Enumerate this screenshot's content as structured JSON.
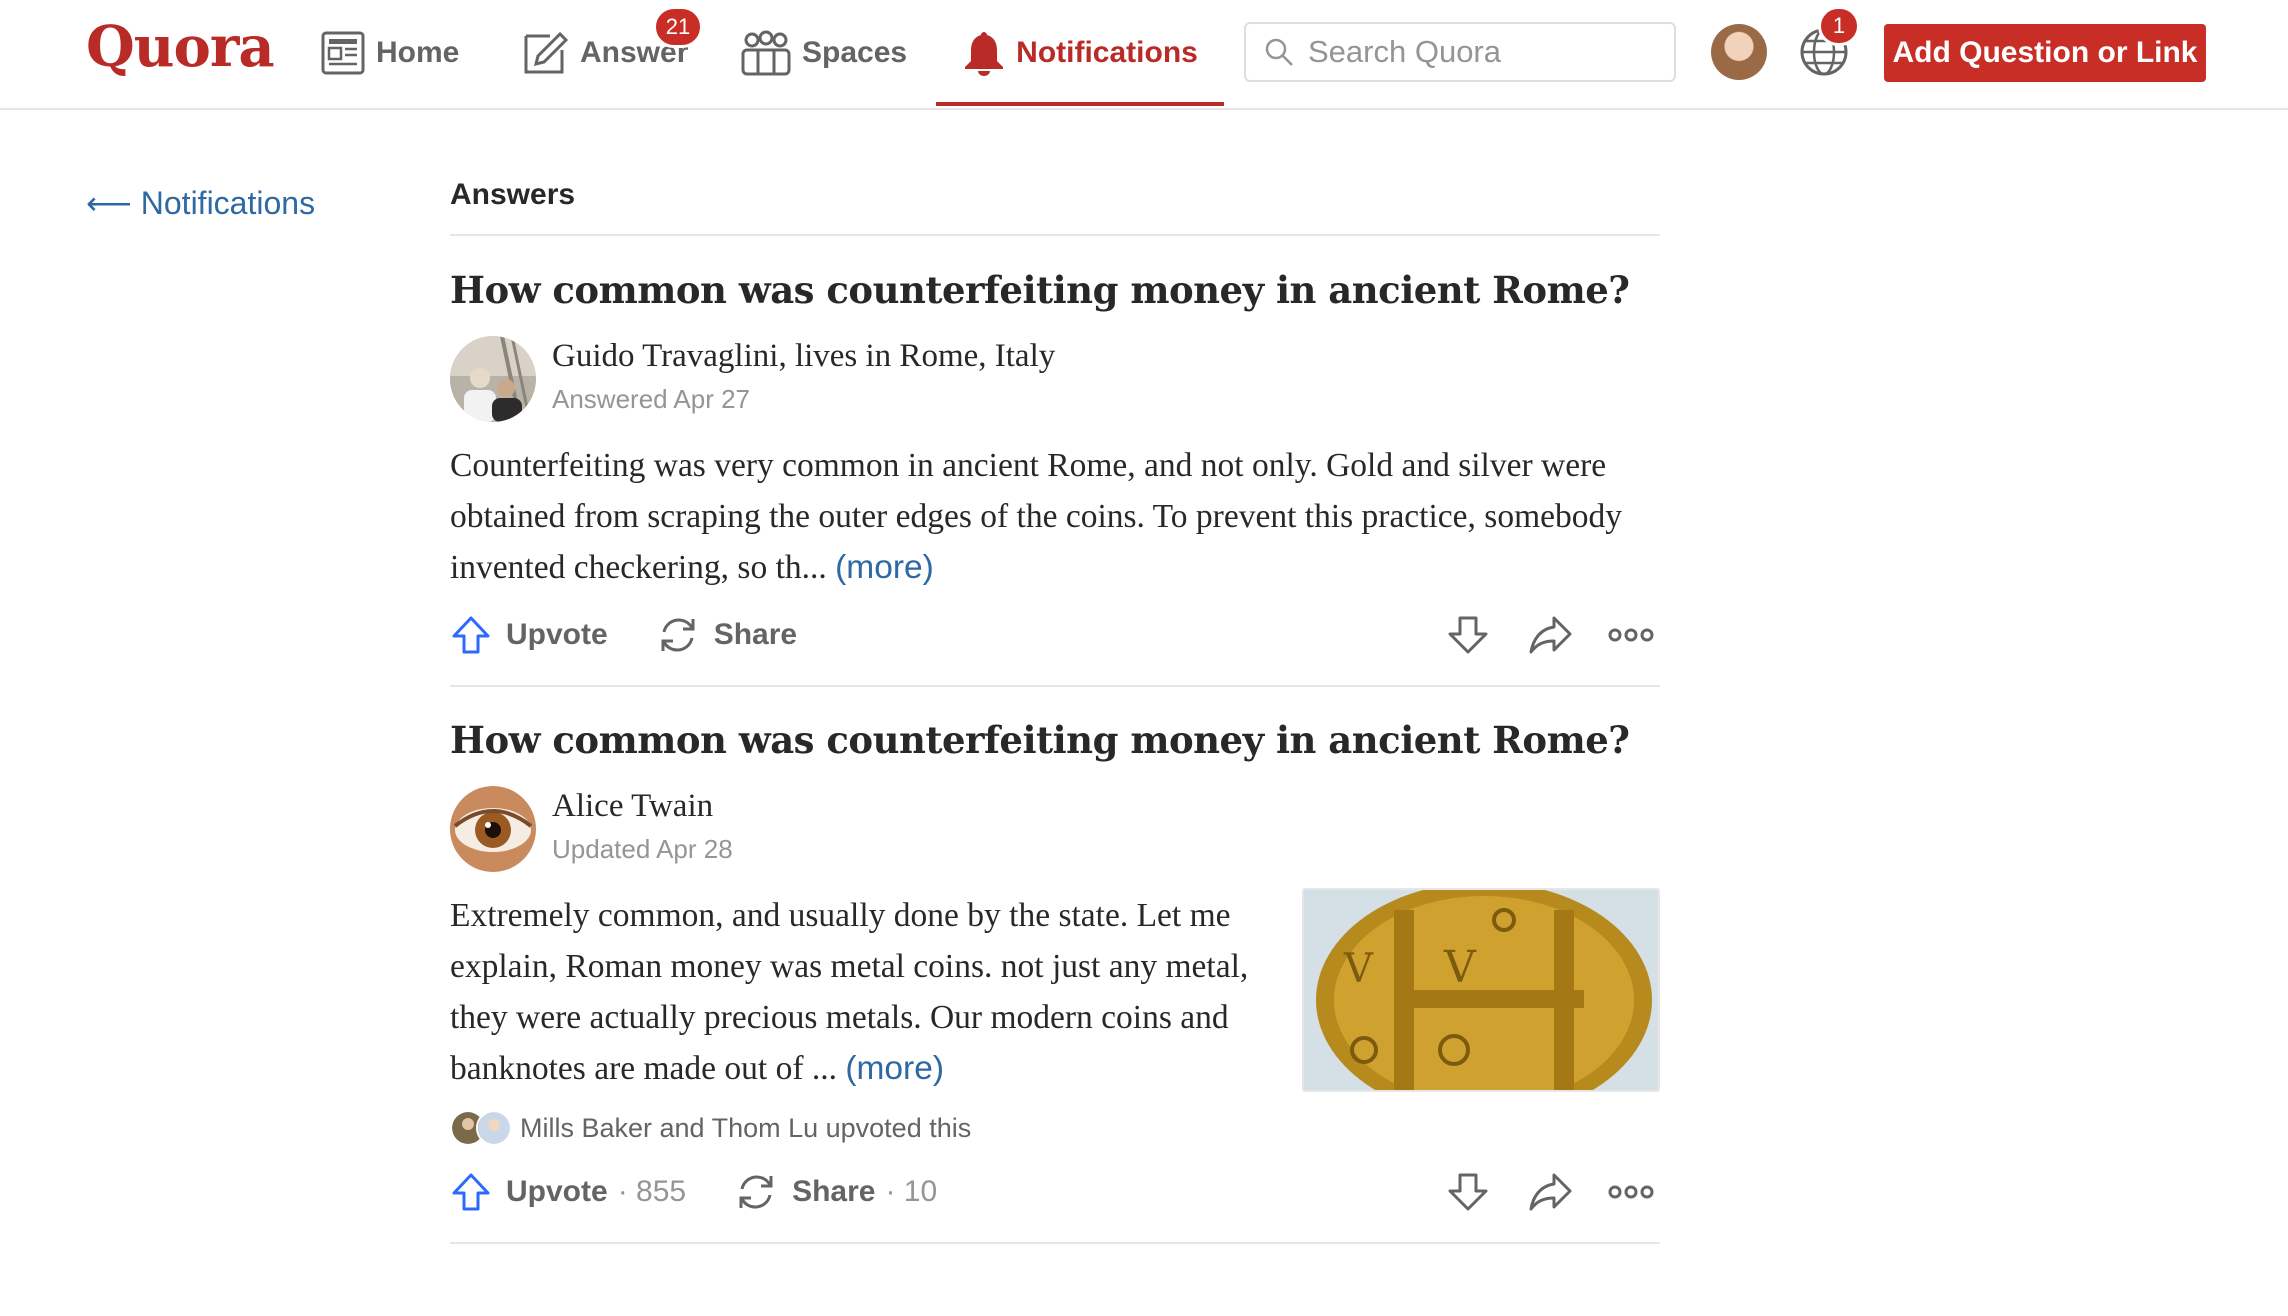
{
  "header": {
    "logo": "Quora",
    "nav": {
      "home": "Home",
      "answer": "Answer",
      "answer_badge": "21",
      "spaces": "Spaces",
      "notifications": "Notifications"
    },
    "search_placeholder": "Search Quora",
    "globe_badge": "1",
    "add_button": "Add Question or Link"
  },
  "sidebar": {
    "back_link": "⟵ Notifications"
  },
  "feed": {
    "section_title": "Answers",
    "answers": [
      {
        "question": "How common was counterfeiting money in ancient Rome?",
        "author": "Guido Travaglini, lives in Rome, Italy",
        "meta": "Answered Apr 27",
        "text": "Counterfeiting was very common in ancient Rome, and not only. Gold and silver were obtained from scraping the outer edges of the coins. To prevent this practice, somebody invented checkering, so th...",
        "more": "(more)",
        "upvote_label": "Upvote",
        "share_label": "Share"
      },
      {
        "question": "How common was counterfeiting money in ancient Rome?",
        "author": "Alice Twain",
        "meta": "Updated Apr 28",
        "text": "Extremely common, and usually done by the state. Let me explain, Roman money was metal coins. not just any metal, they were actually precious metals. Our modern coins and banknotes are made out of ...",
        "more": "(more)",
        "upvoted_by": "Mills Baker and Thom Lu upvoted this",
        "upvote_label": "Upvote",
        "upvote_count": "· 855",
        "share_label": "Share",
        "share_count": "· 10"
      }
    ]
  },
  "colors": {
    "brand": "#b92b27",
    "button_red": "#c82e26",
    "link_blue": "#2e69a3",
    "upvote_blue": "#2e69ff"
  },
  "icons": [
    "home-icon",
    "answer-pencil-icon",
    "spaces-icon",
    "bell-icon",
    "search-icon",
    "globe-icon",
    "upvote-arrow-icon",
    "share-icon",
    "downvote-arrow-icon",
    "forward-share-icon",
    "more-dots-icon"
  ]
}
